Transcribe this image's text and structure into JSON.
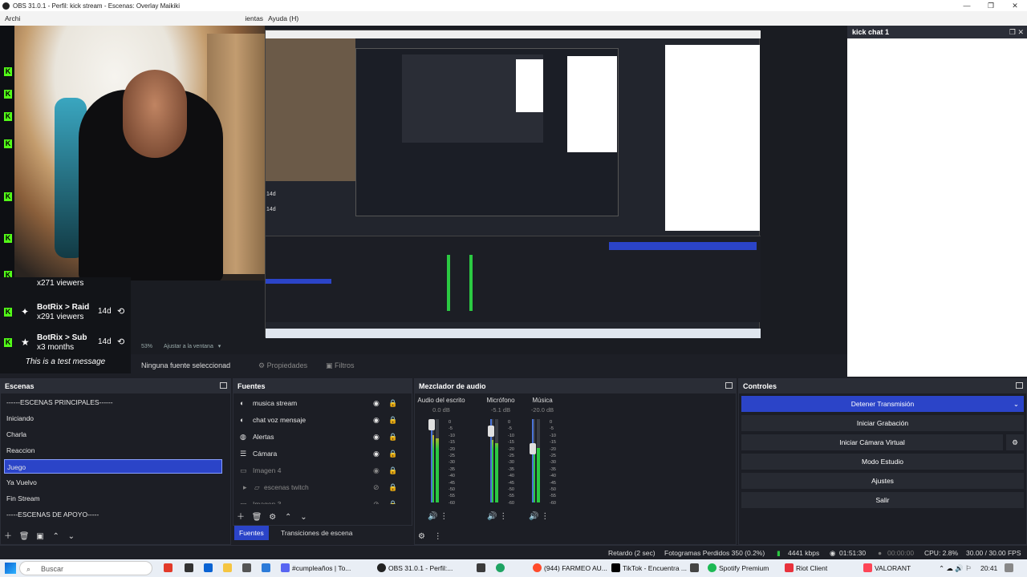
{
  "titlebar": {
    "title": "OBS 31.0.1 - Perfil: kick stream - Escenas: Overlay Maikiki",
    "min": "—",
    "max": "❐",
    "close": "✕"
  },
  "menubar": {
    "left_fragment": "Archi",
    "items_visible": [
      "ientas",
      "Ayuda (H)"
    ]
  },
  "chat_dock": {
    "title": "kick chat 1"
  },
  "alerts": {
    "top_partial": "x271 viewers",
    "rows": [
      {
        "name": "BotRix > Raid",
        "sub": "x291 viewers",
        "time": "14d"
      },
      {
        "name": "BotRix > Sub",
        "sub": "x3 months",
        "time": "14d"
      }
    ],
    "test_message": "This is a test message",
    "rail_times": [
      "14d",
      "14d"
    ]
  },
  "zoom": {
    "value": "53%",
    "label": "Ajustar a la ventana"
  },
  "source_toolbar": {
    "no_source": "Ninguna fuente seleccionad",
    "properties": "Propiedades",
    "filters": "Filtros"
  },
  "scenes": {
    "title": "Escenas",
    "items": [
      "------ESCENAS PRINCIPALES------",
      "Iniciando",
      "Charla",
      "Reaccion",
      "Juego",
      "Ya Vuelvo",
      "Fin Stream",
      "-----ESCENAS DE APOYO-----"
    ],
    "selected_index": 4
  },
  "sources": {
    "title": "Fuentes",
    "items": [
      {
        "label": "musica stream",
        "icon": "speaker-icon",
        "visible": true,
        "dim": false
      },
      {
        "label": "chat voz mensaje",
        "icon": "speaker-icon",
        "visible": true,
        "dim": false
      },
      {
        "label": "Alertas",
        "icon": "globe-icon",
        "visible": true,
        "dim": false
      },
      {
        "label": "Cámara",
        "icon": "list-icon",
        "visible": true,
        "dim": false
      },
      {
        "label": "Imagen 4",
        "icon": "image-icon",
        "visible": true,
        "dim": true
      },
      {
        "label": "escenas twitch",
        "icon": "folder-icon",
        "visible": false,
        "dim": true
      },
      {
        "label": "Imagen 3",
        "icon": "image-icon",
        "visible": false,
        "dim": true
      }
    ],
    "tabs": [
      "Fuentes",
      "Transiciones de escena"
    ]
  },
  "mixer": {
    "title": "Mezclador de audio",
    "channels": [
      {
        "name": "Audio del escrito",
        "db": "0.0 dB",
        "level_db": 0.0
      },
      {
        "name": "Micrófono",
        "db": "-5.1 dB",
        "level_db": -5.1
      },
      {
        "name": "Música",
        "db": "-20.0 dB",
        "level_db": -20.0
      }
    ],
    "scale": [
      "0",
      "-5",
      "-10",
      "-15",
      "-20",
      "-25",
      "-30",
      "-35",
      "-40",
      "-45",
      "-50",
      "-55",
      "-60"
    ]
  },
  "controls": {
    "title": "Controles",
    "buttons": [
      "Detener Transmisión",
      "Iniciar Grabación",
      "Iniciar Cámara Virtual",
      "Modo Estudio",
      "Ajustes",
      "Salir"
    ]
  },
  "status": {
    "delay": "Retardo (2 sec)",
    "frames": "Fotogramas Perdidos 350 (0.2%)",
    "kbps": "4441 kbps",
    "stream_time": "01:51:30",
    "rec_time": "00:00:00",
    "cpu": "CPU: 2.8%",
    "fps": "30.00 / 30.00 FPS"
  },
  "taskbar": {
    "search": "Buscar",
    "items": [
      "#cumpleaños | To...",
      "OBS 31.0.1 - Perfil:...",
      "(944) FARMEO AU...",
      "TikTok - Encuentra ...",
      "Spotify Premium",
      "Riot Client",
      "VALORANT"
    ],
    "clock": "20:41"
  },
  "colors": {
    "accent": "#2b44c8",
    "kick_green": "#53fc18",
    "panel": "#1c1e25"
  }
}
